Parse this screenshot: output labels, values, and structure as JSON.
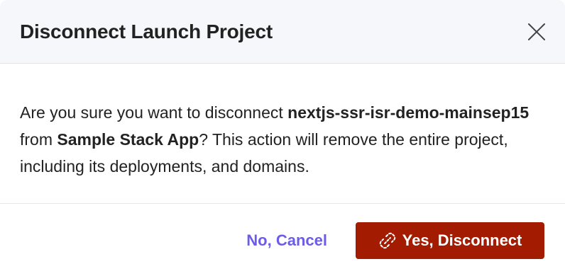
{
  "dialog": {
    "title": "Disconnect Launch Project",
    "close_icon": "close-icon",
    "message": {
      "prefix": "Are you sure you want to disconnect ",
      "project_name": "nextjs-ssr-isr-demo-mainsep15",
      "middle": " from ",
      "app_name": "Sample Stack App",
      "suffix": "? This action will remove the entire project, including its deployments, and domains."
    },
    "cancel_label": "No, Cancel",
    "confirm_label": "Yes, Disconnect",
    "confirm_icon": "unlink-icon",
    "colors": {
      "header_bg": "#f5f7fb",
      "cancel_text": "#6c5ce7",
      "confirm_bg": "#a31b00",
      "title_text": "#222222"
    }
  }
}
